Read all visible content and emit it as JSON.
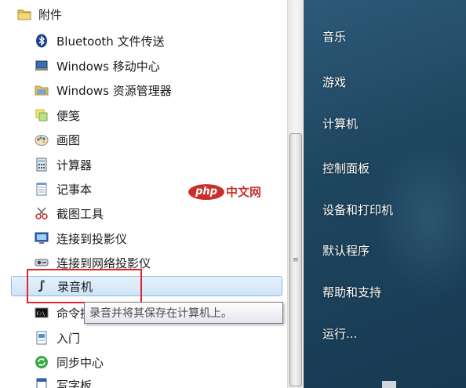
{
  "folder": {
    "label": "附件",
    "icon": "folder-icon"
  },
  "programs": [
    {
      "name": "prog-bluetooth",
      "label": "Bluetooth 文件传送",
      "icon": "bluetooth-icon"
    },
    {
      "name": "prog-mobility-center",
      "label": "Windows 移动中心",
      "icon": "laptop-icon"
    },
    {
      "name": "prog-explorer",
      "label": "Windows 资源管理器",
      "icon": "folder-explorer-icon"
    },
    {
      "name": "prog-sticky-notes",
      "label": "便笺",
      "icon": "sticky-note-icon"
    },
    {
      "name": "prog-paint",
      "label": "画图",
      "icon": "paint-palette-icon"
    },
    {
      "name": "prog-calculator",
      "label": "计算器",
      "icon": "calculator-icon"
    },
    {
      "name": "prog-notepad",
      "label": "记事本",
      "icon": "notepad-icon"
    },
    {
      "name": "prog-snipping",
      "label": "截图工具",
      "icon": "scissors-icon"
    },
    {
      "name": "prog-projector",
      "label": "连接到投影仪",
      "icon": "projector-icon"
    },
    {
      "name": "prog-network-projector",
      "label": "连接到网络投影仪",
      "icon": "network-projector-icon"
    },
    {
      "name": "prog-sound-recorder",
      "label": "录音机",
      "icon": "microphone-icon",
      "selected": true
    },
    {
      "name": "prog-cmd",
      "label": "命令提示符",
      "icon": "cmd-icon"
    },
    {
      "name": "prog-getting-started",
      "label": "入门",
      "icon": "getting-started-icon"
    },
    {
      "name": "prog-sync-center",
      "label": "同步中心",
      "icon": "sync-icon"
    },
    {
      "name": "prog-wordpad",
      "label": "写字板",
      "icon": "wordpad-icon"
    }
  ],
  "tooltip": {
    "text": "录音并将其保存在计算机上。"
  },
  "right_links": [
    {
      "name": "link-music",
      "label": "音乐"
    },
    {
      "name": "link-games",
      "label": "游戏"
    },
    {
      "name": "link-computer",
      "label": "计算机"
    },
    {
      "name": "link-control-panel",
      "label": "控制面板"
    },
    {
      "name": "link-devices-printers",
      "label": "设备和打印机"
    },
    {
      "name": "link-default-programs",
      "label": "默认程序"
    },
    {
      "name": "link-help-support",
      "label": "帮助和支持"
    },
    {
      "name": "link-run",
      "label": "运行..."
    }
  ],
  "watermark": {
    "logo": "php",
    "site": "中文网"
  },
  "colors": {
    "highlight_border": "#e0242b",
    "selection": "#cfe4f8",
    "right_pane": "#1f4660"
  }
}
